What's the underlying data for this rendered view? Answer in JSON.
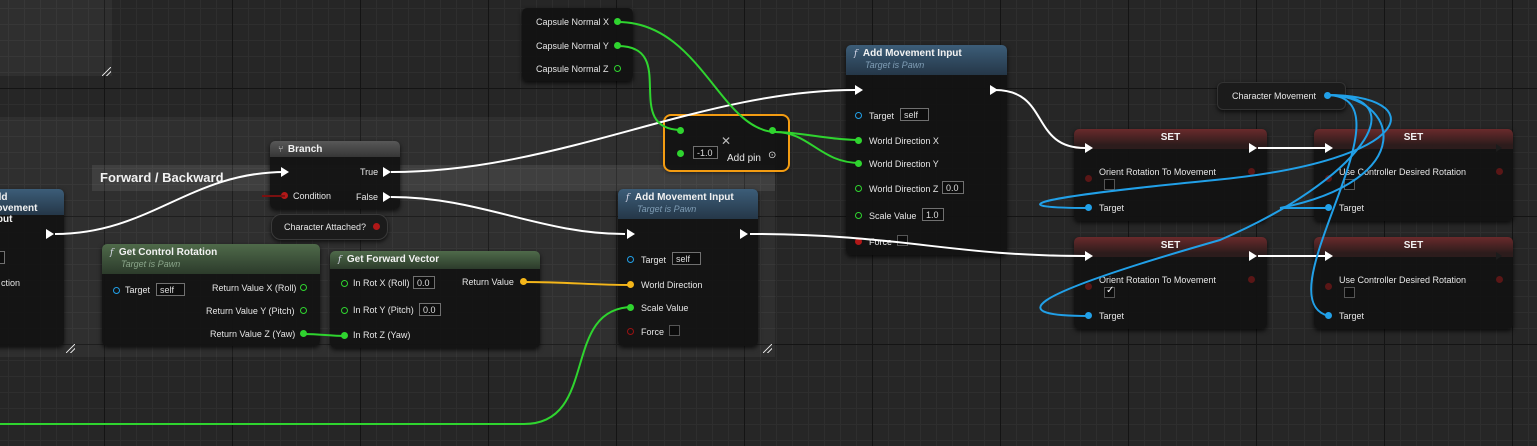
{
  "comment": {
    "title": "Forward / Backward"
  },
  "nodes": {
    "amiLeft": {
      "title": "Add Movement Input",
      "partial_row": "ction"
    },
    "branch": {
      "title": "Branch",
      "true_label": "True",
      "false_label": "False",
      "condition_label": "Condition"
    },
    "characterAttached": {
      "label": "Character Attached?"
    },
    "getControlRotation": {
      "title": "Get Control Rotation",
      "subtitle": "Target is Pawn",
      "target_label": "Target",
      "target_value": "self",
      "out_x": "Return Value X (Roll)",
      "out_y": "Return Value Y (Pitch)",
      "out_z": "Return Value Z (Yaw)"
    },
    "getForwardVector": {
      "title": "Get Forward Vector",
      "in_x": "In Rot X (Roll)",
      "in_x_value": "0.0",
      "in_y": "In Rot Y (Pitch)",
      "in_y_value": "0.0",
      "in_z": "In Rot Z (Yaw)",
      "return_label": "Return Value"
    },
    "amiMid": {
      "title": "Add Movement Input",
      "subtitle": "Target is Pawn",
      "target_label": "Target",
      "target_value": "self",
      "world_direction": "World Direction",
      "scale_value": "Scale Value",
      "force": "Force"
    },
    "capsule": {
      "x": "Capsule Normal X",
      "y": "Capsule Normal Y",
      "z": "Capsule Normal Z"
    },
    "makeVector": {
      "value": "-1.0",
      "add_pin": "Add pin"
    },
    "amiTop": {
      "title": "Add Movement Input",
      "subtitle": "Target is Pawn",
      "target_label": "Target",
      "target_value": "self",
      "wd_x": "World Direction X",
      "wd_y": "World Direction Y",
      "wd_z": "World Direction Z",
      "wd_z_value": "0.0",
      "scale_value": "Scale Value",
      "scale_value_value": "1.0",
      "force": "Force"
    },
    "characterMovement": {
      "label": "Character Movement"
    },
    "set1": {
      "title": "SET",
      "prop": "Orient Rotation To Movement",
      "target": "Target",
      "checked": false
    },
    "set2": {
      "title": "SET",
      "prop": "Use Controller Desired Rotation",
      "target": "Target",
      "checked": false
    },
    "set3": {
      "title": "SET",
      "prop": "Orient Rotation To Movement",
      "target": "Target",
      "checked": true
    },
    "set4": {
      "title": "SET",
      "prop": "Use Controller Desired Rotation",
      "target": "Target",
      "checked": false
    }
  },
  "colors": {
    "exec": "#ffffff",
    "float": "#2fd42f",
    "object": "#21a0e8",
    "vector": "#f4b61a",
    "bool": "#9a1212",
    "selection": "#f39c12"
  },
  "icons": [
    "function-icon",
    "branch-icon",
    "close-icon",
    "add-pin-icon",
    "resize-corner-icon"
  ]
}
